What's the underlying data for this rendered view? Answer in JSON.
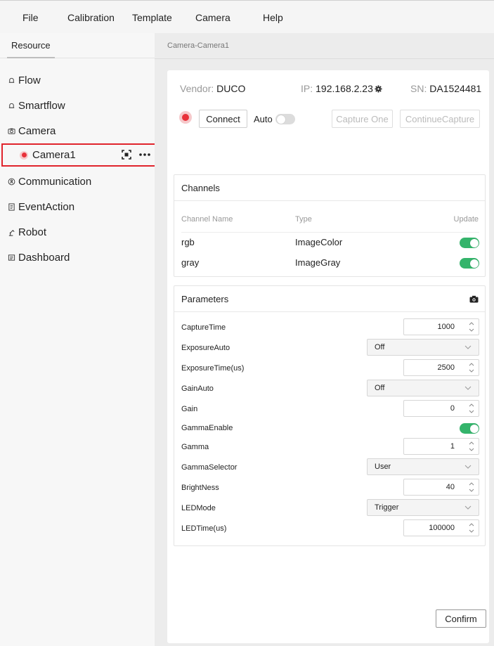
{
  "menu": [
    "File",
    "Calibration",
    "Template",
    "Camera",
    "Help"
  ],
  "sidebar": {
    "tab": "Resource",
    "items": [
      {
        "label": "Flow",
        "icon": "bell-icon"
      },
      {
        "label": "Smartflow",
        "icon": "bell-icon"
      },
      {
        "label": "Camera",
        "icon": "camera-icon"
      },
      {
        "label": "Communication",
        "icon": "network-icon"
      },
      {
        "label": "EventAction",
        "icon": "document-icon"
      },
      {
        "label": "Robot",
        "icon": "robot-arm-icon"
      },
      {
        "label": "Dashboard",
        "icon": "dashboard-icon"
      }
    ],
    "selected_child": {
      "label": "Camera1",
      "status_color": "#e8313a"
    }
  },
  "breadcrumb": "Camera-Camera1",
  "device": {
    "vendor_label": "Vendor:",
    "vendor": "DUCO",
    "ip_label": "IP:",
    "ip": "192.168.2.23",
    "sn_label": "SN:",
    "sn": "DA1524481"
  },
  "controls": {
    "connect": "Connect",
    "auto": "Auto",
    "auto_on": false,
    "capture_one": "Capture One",
    "continue_capture": "ContinueCapture"
  },
  "channels": {
    "title": "Channels",
    "headers": [
      "Channel Name",
      "Type",
      "Update"
    ],
    "rows": [
      {
        "name": "rgb",
        "type": "ImageColor",
        "update": true
      },
      {
        "name": "gray",
        "type": "ImageGray",
        "update": true
      }
    ]
  },
  "parameters": {
    "title": "Parameters",
    "rows": [
      {
        "label": "CaptureTime",
        "kind": "number",
        "value": "1000"
      },
      {
        "label": "ExposureAuto",
        "kind": "select",
        "value": "Off"
      },
      {
        "label": "ExposureTime(us)",
        "kind": "number",
        "value": "2500"
      },
      {
        "label": "GainAuto",
        "kind": "select",
        "value": "Off"
      },
      {
        "label": "Gain",
        "kind": "number",
        "value": "0"
      },
      {
        "label": "GammaEnable",
        "kind": "toggle",
        "value": true
      },
      {
        "label": "Gamma",
        "kind": "number",
        "value": "1"
      },
      {
        "label": "GammaSelector",
        "kind": "select",
        "value": "User"
      },
      {
        "label": "BrightNess",
        "kind": "number",
        "value": "40"
      },
      {
        "label": "LEDMode",
        "kind": "select",
        "value": "Trigger"
      },
      {
        "label": "LEDTime(us)",
        "kind": "number",
        "value": "100000"
      }
    ]
  },
  "confirm": "Confirm",
  "colors": {
    "accent_green": "#34b46b",
    "status_red": "#e8313a",
    "highlight_border": "#e0242c"
  }
}
